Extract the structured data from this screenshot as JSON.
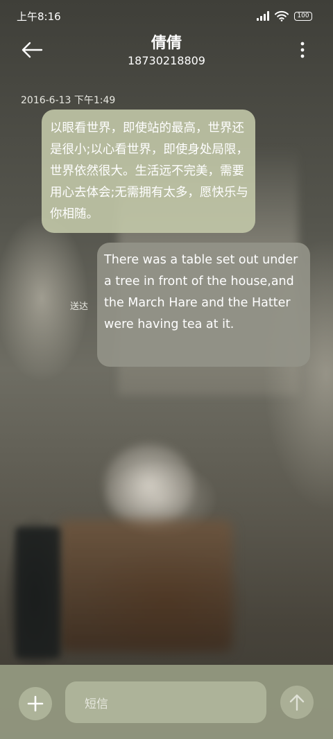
{
  "status_bar": {
    "time": "上午8:16",
    "battery": "100",
    "icons": [
      "signal-icon",
      "wifi-icon",
      "battery-icon"
    ]
  },
  "header": {
    "contact_name": "倩倩",
    "contact_number": "18730218809",
    "back_icon": "arrow-left-icon",
    "more_icon": "more-vertical-icon"
  },
  "conversation": {
    "timestamp": "2016-6-13 下午1:49",
    "messages": [
      {
        "direction": "incoming",
        "text": "以眼看世界，即使站的最高，世界还是很小;以心看世界，即使身处局限，世界依然很大。生活远不完美，需要用心去体会;无需拥有太多，愿快乐与你相随。"
      },
      {
        "direction": "outgoing",
        "text": "There was a table set out under a tree in front of the house,and the March Hare and the Hatter were having tea at it.",
        "status": "送达"
      }
    ]
  },
  "composer": {
    "placeholder": "短信",
    "add_icon": "plus-icon",
    "send_icon": "arrow-up-icon"
  },
  "colors": {
    "incoming_bubble": "#c4caaa",
    "outgoing_bubble": "#949488",
    "input_bar": "#969b82"
  }
}
